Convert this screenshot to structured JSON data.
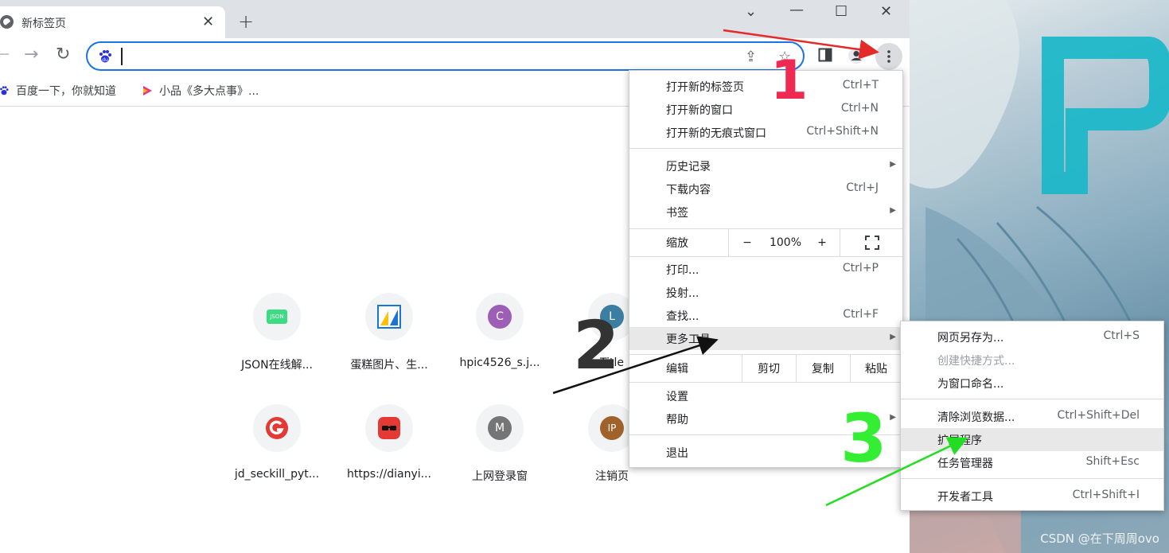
{
  "tab": {
    "title": "新标签页"
  },
  "bookmarks": [
    {
      "label": "百度一下，你就知道"
    },
    {
      "label": "小品《多大点事》..."
    }
  ],
  "shortcuts": [
    {
      "label": "JSON在线解...",
      "icon": "json-icon",
      "text": "JSON",
      "color": "#3ddc84"
    },
    {
      "label": "蛋糕图片、生...",
      "icon": "image-icon"
    },
    {
      "label": "hpic4526_s.j...",
      "text": "C",
      "color": "#9c5fb5"
    },
    {
      "label": "Title",
      "text": "L",
      "color": "#3b7ea1"
    },
    {
      "label": "jd_seckill_pyt...",
      "icon": "g-logo-icon",
      "color": "#e53935"
    },
    {
      "label": "https://dianyi...",
      "icon": "glasses-icon",
      "color": "#e53935"
    },
    {
      "label": "上网登录窗",
      "text": "M",
      "color": "#757575"
    },
    {
      "label": "注销页",
      "text": "IP",
      "color": "#a0622a"
    }
  ],
  "main_menu": {
    "group1": [
      {
        "label": "打开新的标签页",
        "shortcut": "Ctrl+T"
      },
      {
        "label": "打开新的窗口",
        "shortcut": "Ctrl+N"
      },
      {
        "label": "打开新的无痕式窗口",
        "shortcut": "Ctrl+Shift+N"
      }
    ],
    "group2": [
      {
        "label": "历史记录",
        "submenu": true
      },
      {
        "label": "下载内容",
        "shortcut": "Ctrl+J"
      },
      {
        "label": "书签",
        "submenu": true
      }
    ],
    "zoom": {
      "label": "缩放",
      "minus": "−",
      "value": "100%",
      "plus": "+"
    },
    "group3": [
      {
        "label": "打印...",
        "shortcut": "Ctrl+P"
      },
      {
        "label": "投射..."
      },
      {
        "label": "查找...",
        "shortcut": "Ctrl+F"
      },
      {
        "label": "更多工具",
        "submenu": true,
        "highlighted": true
      }
    ],
    "edit": {
      "label": "编辑",
      "cut": "剪切",
      "copy": "复制",
      "paste": "粘贴"
    },
    "group4": [
      {
        "label": "设置"
      },
      {
        "label": "帮助",
        "submenu": true
      }
    ],
    "exit": {
      "label": "退出"
    }
  },
  "submenu": {
    "group1": [
      {
        "label": "网页另存为...",
        "shortcut": "Ctrl+S"
      },
      {
        "label": "创建快捷方式...",
        "disabled": true
      },
      {
        "label": "为窗口命名..."
      }
    ],
    "group2": [
      {
        "label": "清除浏览数据...",
        "shortcut": "Ctrl+Shift+Del"
      },
      {
        "label": "扩展程序",
        "highlighted": true
      },
      {
        "label": "任务管理器",
        "shortcut": "Shift+Esc"
      }
    ],
    "group3": [
      {
        "label": "开发者工具",
        "shortcut": "Ctrl+Shift+I"
      }
    ]
  },
  "annotations": {
    "n1": "1",
    "n2": "2",
    "n3": "3"
  },
  "watermark": "CSDN @在下周周ovo"
}
